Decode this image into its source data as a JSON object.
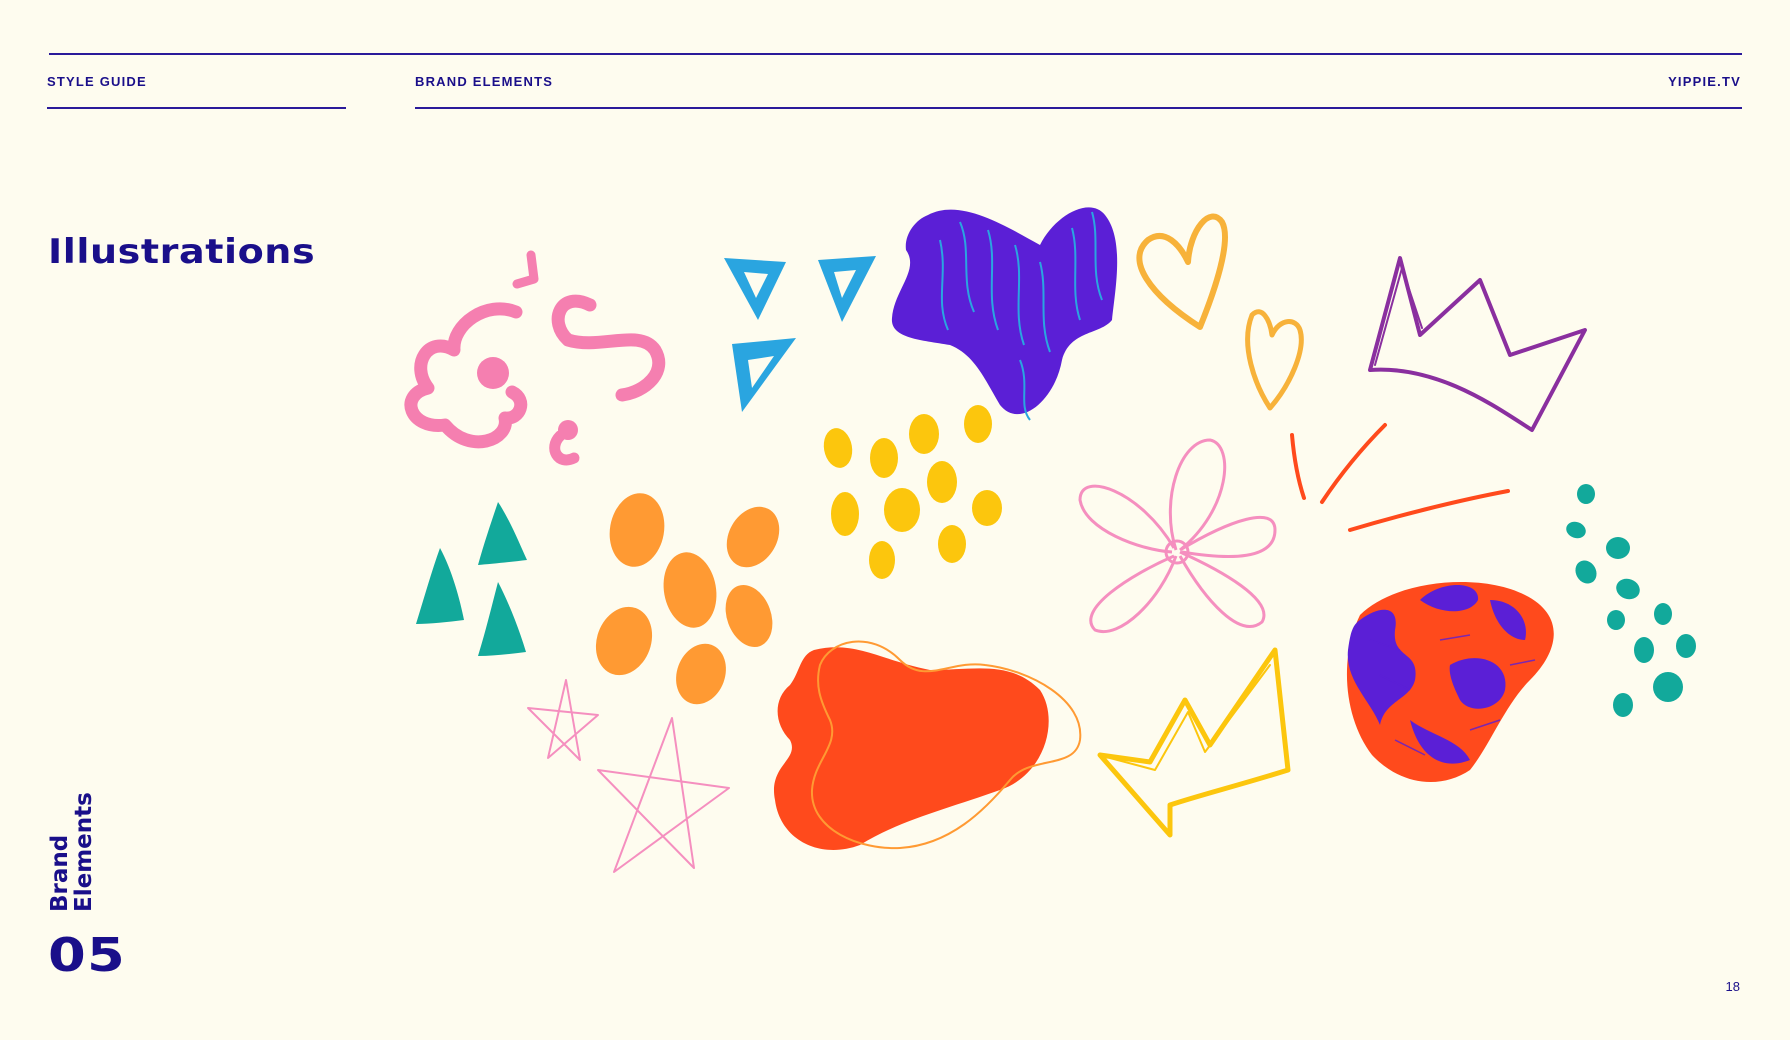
{
  "header": {
    "left_label": "STYLE GUIDE",
    "center_label": "BRAND ELEMENTS",
    "right_label": "YIPPIE.TV"
  },
  "section": {
    "title": "Illustrations",
    "vertical_label_line1": "Brand",
    "vertical_label_line2": "Elements",
    "number": "05"
  },
  "footer": {
    "page_number": "18"
  },
  "colors": {
    "background": "#fefcef",
    "navy": "#1a0f8a",
    "pink": "#f57fb0",
    "blue": "#2aa5e0",
    "purple": "#5b1fd6",
    "orange": "#ff9a33",
    "yellow": "#fcc60d",
    "red_orange": "#ff4a1c",
    "teal": "#12a99b",
    "gold": "#f7b23a",
    "crown_purple": "#8a2f9f"
  },
  "illustrations": [
    "pink-squiggle",
    "blue-triangles",
    "purple-blob",
    "orange-hearts",
    "purple-crown",
    "teal-triangles",
    "orange-dots",
    "yellow-dots",
    "pink-flower",
    "red-strokes",
    "teal-dots",
    "pink-stars",
    "red-blob",
    "yellow-crown",
    "textured-blob"
  ]
}
